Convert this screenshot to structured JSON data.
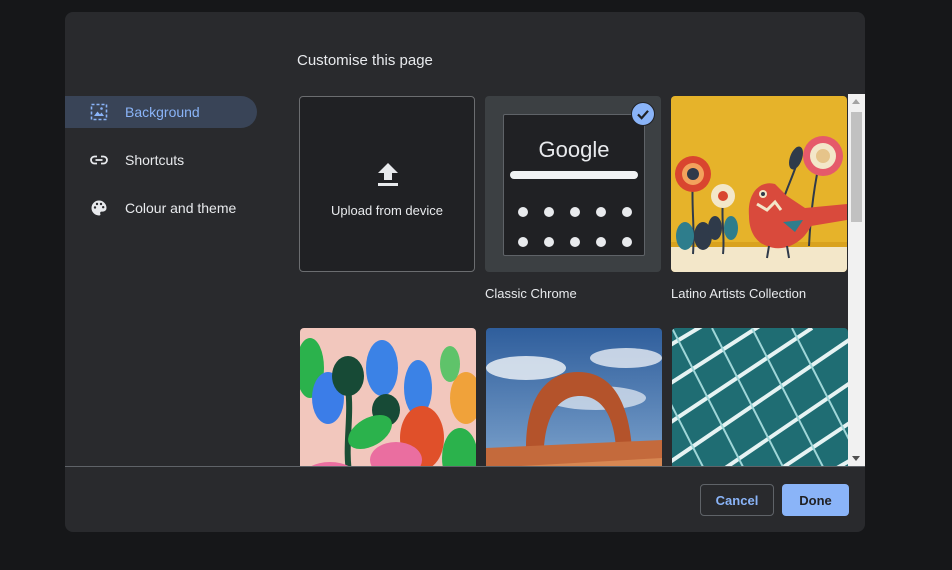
{
  "dialog": {
    "title": "Customise this page"
  },
  "nav": {
    "items": [
      {
        "label": "Background",
        "icon": "background-icon",
        "active": true
      },
      {
        "label": "Shortcuts",
        "icon": "link-icon",
        "active": false
      },
      {
        "label": "Colour and theme",
        "icon": "palette-icon",
        "active": false
      }
    ]
  },
  "tiles": {
    "upload": {
      "label": "Upload from device",
      "icon": "upload-icon"
    },
    "classic_chrome": {
      "caption": "Classic Chrome",
      "logo_text": "Google",
      "selected": true
    },
    "latino_artists": {
      "caption": "Latino Artists Collection"
    },
    "row2": [
      "floral-illustration",
      "rock-arch-photo",
      "geometric-architecture-photo"
    ]
  },
  "footer": {
    "cancel_label": "Cancel",
    "done_label": "Done"
  },
  "colors": {
    "accent": "#8ab4f8",
    "dialog_bg": "#292a2d",
    "nav_active_bg": "#394457",
    "text": "#e8eaed"
  }
}
